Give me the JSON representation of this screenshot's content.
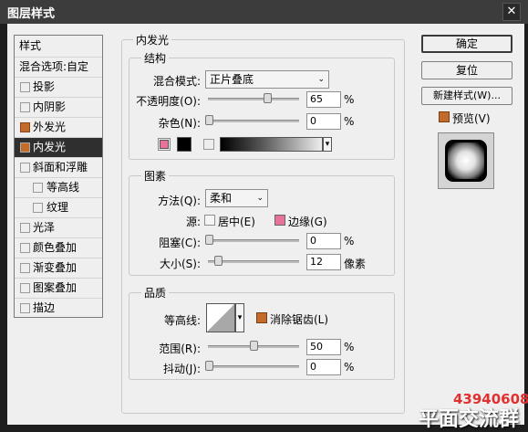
{
  "window": {
    "title": "图层样式",
    "close_symbol": "✕"
  },
  "left_panel": {
    "header": "样式",
    "blend_options": "混合选项:自定",
    "items": [
      {
        "label": "投影",
        "checked": false
      },
      {
        "label": "内阴影",
        "checked": false
      },
      {
        "label": "外发光",
        "checked": true
      },
      {
        "label": "内发光",
        "checked": true,
        "selected": true
      },
      {
        "label": "斜面和浮雕",
        "checked": false
      },
      {
        "label": "等高线",
        "checked": false,
        "sub": true
      },
      {
        "label": "纹理",
        "checked": false,
        "sub": true
      },
      {
        "label": "光泽",
        "checked": false
      },
      {
        "label": "颜色叠加",
        "checked": false
      },
      {
        "label": "渐变叠加",
        "checked": false
      },
      {
        "label": "图案叠加",
        "checked": false
      },
      {
        "label": "描边",
        "checked": false
      }
    ]
  },
  "inner_glow": {
    "title": "内发光",
    "structure": {
      "title": "结构",
      "blend_mode_label": "混合模式:",
      "blend_mode_value": "正片叠底",
      "opacity_label": "不透明度(O):",
      "opacity_value": "65",
      "opacity_unit": "%",
      "noise_label": "杂色(N):",
      "noise_value": "0",
      "noise_unit": "%",
      "glow_color": "#e8739a",
      "second_color": "#000000"
    },
    "elements": {
      "title": "图素",
      "technique_label": "方法(Q):",
      "technique_value": "柔和",
      "source_label": "源:",
      "center_label": "居中(E)",
      "edge_label": "边缘(G)",
      "edge_color": "#e8739a",
      "choke_label": "阻塞(C):",
      "choke_value": "0",
      "choke_unit": "%",
      "size_label": "大小(S):",
      "size_value": "12",
      "size_unit": "像素"
    },
    "quality": {
      "title": "品质",
      "contour_label": "等高线:",
      "anti_alias_label": "消除锯齿(L)",
      "anti_alias_checked": true,
      "range_label": "范围(R):",
      "range_value": "50",
      "range_unit": "%",
      "jitter_label": "抖动(J):",
      "jitter_value": "0",
      "jitter_unit": "%"
    }
  },
  "right_panel": {
    "ok_label": "确定",
    "reset_label": "复位",
    "new_style_label": "新建样式(W)...",
    "preview_label": "预览(V)",
    "preview_checked": true
  },
  "watermark": {
    "number": "43940608",
    "text": "平面交流群"
  },
  "colors": {
    "accent": "#c36b2b",
    "selected_bg": "#2f2f2f",
    "dialog_bg": "#efefef"
  }
}
